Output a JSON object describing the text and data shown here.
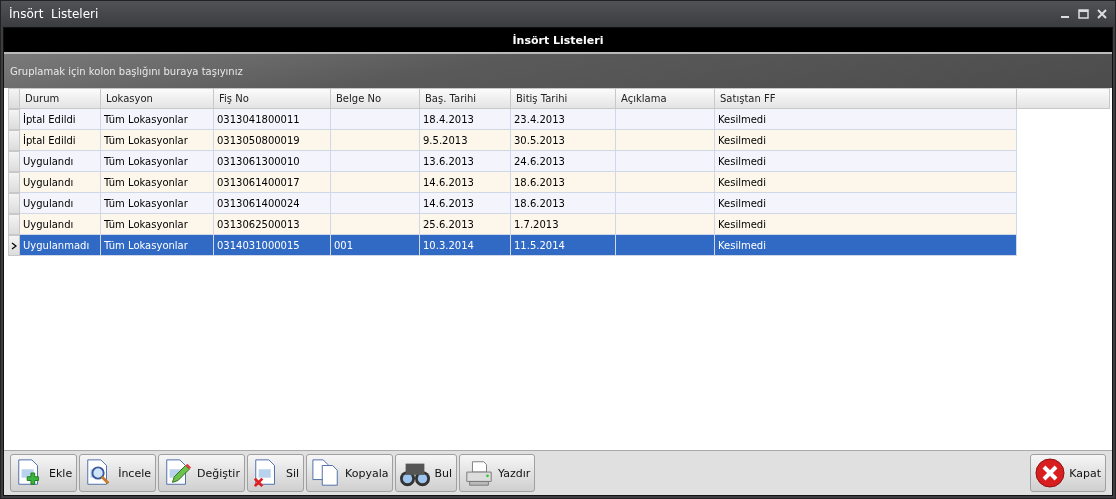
{
  "window": {
    "title": "İnsört  Listeleri"
  },
  "header": {
    "title": "İnsört Listeleri"
  },
  "group_panel": {
    "hint": "Gruplamak için kolon başlığını buraya taşıyınız"
  },
  "table": {
    "columns": [
      "Durum",
      "Lokasyon",
      "Fiş No",
      "Belge No",
      "Baş. Tarihi",
      "Bitiş Tarihi",
      "Açıklama",
      "Satıştan FF"
    ],
    "rows": [
      {
        "selected": false,
        "cells": [
          "İptal Edildi",
          "Tüm Lokasyonlar",
          "0313041800011",
          "",
          "18.4.2013",
          "23.4.2013",
          "",
          "Kesilmedi"
        ]
      },
      {
        "selected": false,
        "cells": [
          "İptal Edildi",
          "Tüm Lokasyonlar",
          "0313050800019",
          "",
          "9.5.2013",
          "30.5.2013",
          "",
          "Kesilmedi"
        ]
      },
      {
        "selected": false,
        "cells": [
          "Uygulandı",
          "Tüm Lokasyonlar",
          "0313061300010",
          "",
          "13.6.2013",
          "24.6.2013",
          "",
          "Kesilmedi"
        ]
      },
      {
        "selected": false,
        "cells": [
          "Uygulandı",
          "Tüm Lokasyonlar",
          "0313061400017",
          "",
          "14.6.2013",
          "18.6.2013",
          "",
          "Kesilmedi"
        ]
      },
      {
        "selected": false,
        "cells": [
          "Uygulandı",
          "Tüm Lokasyonlar",
          "0313061400024",
          "",
          "14.6.2013",
          "18.6.2013",
          "",
          "Kesilmedi"
        ]
      },
      {
        "selected": false,
        "cells": [
          "Uygulandı",
          "Tüm Lokasyonlar",
          "0313062500013",
          "",
          "25.6.2013",
          "1.7.2013",
          "",
          "Kesilmedi"
        ]
      },
      {
        "selected": true,
        "cells": [
          "Uygulanmadı",
          "Tüm Lokasyonlar",
          "0314031000015",
          "001",
          "10.3.2014",
          "11.5.2014",
          "",
          "Kesilmedi"
        ]
      }
    ]
  },
  "toolbar": [
    {
      "kind": "add",
      "label": "Ekle"
    },
    {
      "kind": "view",
      "label": "İncele"
    },
    {
      "kind": "edit",
      "label": "Değiştir"
    },
    {
      "kind": "delete",
      "label": "Sil"
    },
    {
      "kind": "copy",
      "label": "Kopyala"
    },
    {
      "kind": "find",
      "label": "Bul"
    },
    {
      "kind": "print",
      "label": "Yazdır"
    }
  ],
  "close_button": {
    "label": "Kapat"
  }
}
